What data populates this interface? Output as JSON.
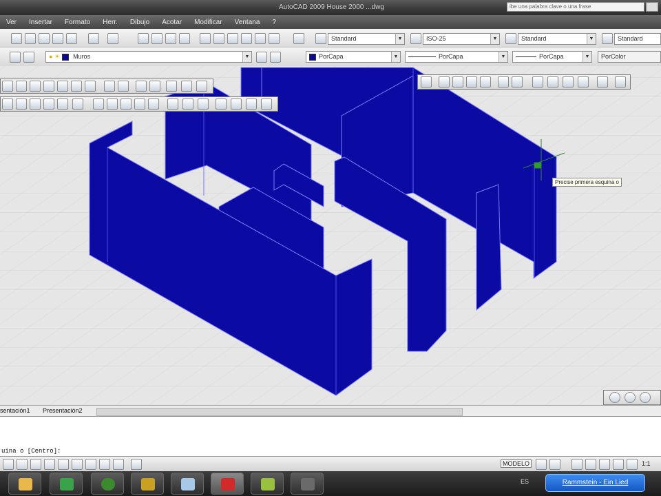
{
  "window": {
    "title": "AutoCAD 2009 House 2000 ...dwg",
    "search_placeholder": "ibe una palabra clave o una frase"
  },
  "menu": [
    "Ver",
    "Insertar",
    "Formato",
    "Herr.",
    "Dibujo",
    "Acotar",
    "Modificar",
    "Ventana",
    "?"
  ],
  "toolbar1": {
    "text_style": "Standard",
    "dim_style": "ISO-25",
    "table_style": "Standard",
    "multileader_style": "Standard"
  },
  "toolbar2": {
    "layer": "Muros",
    "color": "PorCapa",
    "linetype": "PorCapa",
    "lineweight": "PorCapa",
    "plotstyle": "PorColor"
  },
  "drawing": {
    "tooltip": "Precise primera esquina o",
    "wall_color": "#0b0ba3",
    "background_color": "#e6e6e6"
  },
  "layout_tabs": [
    "sentación1",
    "Presentación2"
  ],
  "command_line": {
    "prompt": "uina o [Centro]:"
  },
  "status": {
    "modelo": "MODELO",
    "scale": "1:1"
  },
  "taskbar": {
    "notification": "Rammstein - Ein Lied"
  }
}
